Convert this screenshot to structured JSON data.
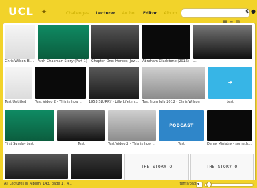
{
  "header": {
    "logo": "UCL",
    "star": "★",
    "tabs": [
      {
        "label": "Challenges",
        "active": false
      },
      {
        "label": "Lecturer",
        "active": true
      },
      {
        "label": "Author",
        "active": false
      },
      {
        "label": "Editor",
        "active": true
      },
      {
        "label": "Album",
        "active": false
      }
    ],
    "search_placeholder": ""
  },
  "toolbar": {
    "view_icons": [
      "▦",
      "≡",
      "▤"
    ]
  },
  "items": [
    {
      "caption": "Chris Wilson Birthday",
      "thumb": "t-doc"
    },
    {
      "caption": "Arch Chapman Story (Part 1)",
      "thumb": "t-green"
    },
    {
      "caption": "Chapter One: Heroes, Jewish Biogr...",
      "thumb": "t-bw"
    },
    {
      "caption": "Abraham Gladstone (2016)",
      "thumb": "t-black"
    },
    {
      "caption": "...",
      "thumb": "t-bw2"
    },
    {
      "caption": "Test Untitled",
      "thumb": "t-doc"
    },
    {
      "caption": "Test Video 2 - This is how ...",
      "thumb": "t-black"
    },
    {
      "caption": "1953 SLURRY - Lilly Lifetime 1953",
      "thumb": "t-bw"
    },
    {
      "caption": "Test from July 2012 - Chris Wilson",
      "thumb": "t-gray"
    },
    {
      "caption": "test",
      "thumb": "t-blue"
    },
    {
      "caption": "First Sunday test",
      "thumb": "t-green"
    },
    {
      "caption": "Test",
      "thumb": "t-bw2"
    },
    {
      "caption": "Test Video 2 - This is how ...",
      "thumb": "t-gray"
    },
    {
      "caption": "Test",
      "thumb": "t-podcast"
    },
    {
      "caption": "Demo Ministry - something...",
      "thumb": "t-black"
    },
    {
      "caption": "",
      "thumb": "t-bw"
    },
    {
      "caption": "",
      "thumb": "t-dark"
    },
    {
      "caption": "",
      "thumb": "t-paper"
    },
    {
      "caption": "",
      "thumb": "t-paper"
    }
  ],
  "overlays": {
    "podcast_label": "PODCAST",
    "story_label": "THE STORY O"
  },
  "status": {
    "left_text": "All Lectures in Album: 143, page 1 / 4...",
    "items_label": "Items/page",
    "items_value": ""
  }
}
